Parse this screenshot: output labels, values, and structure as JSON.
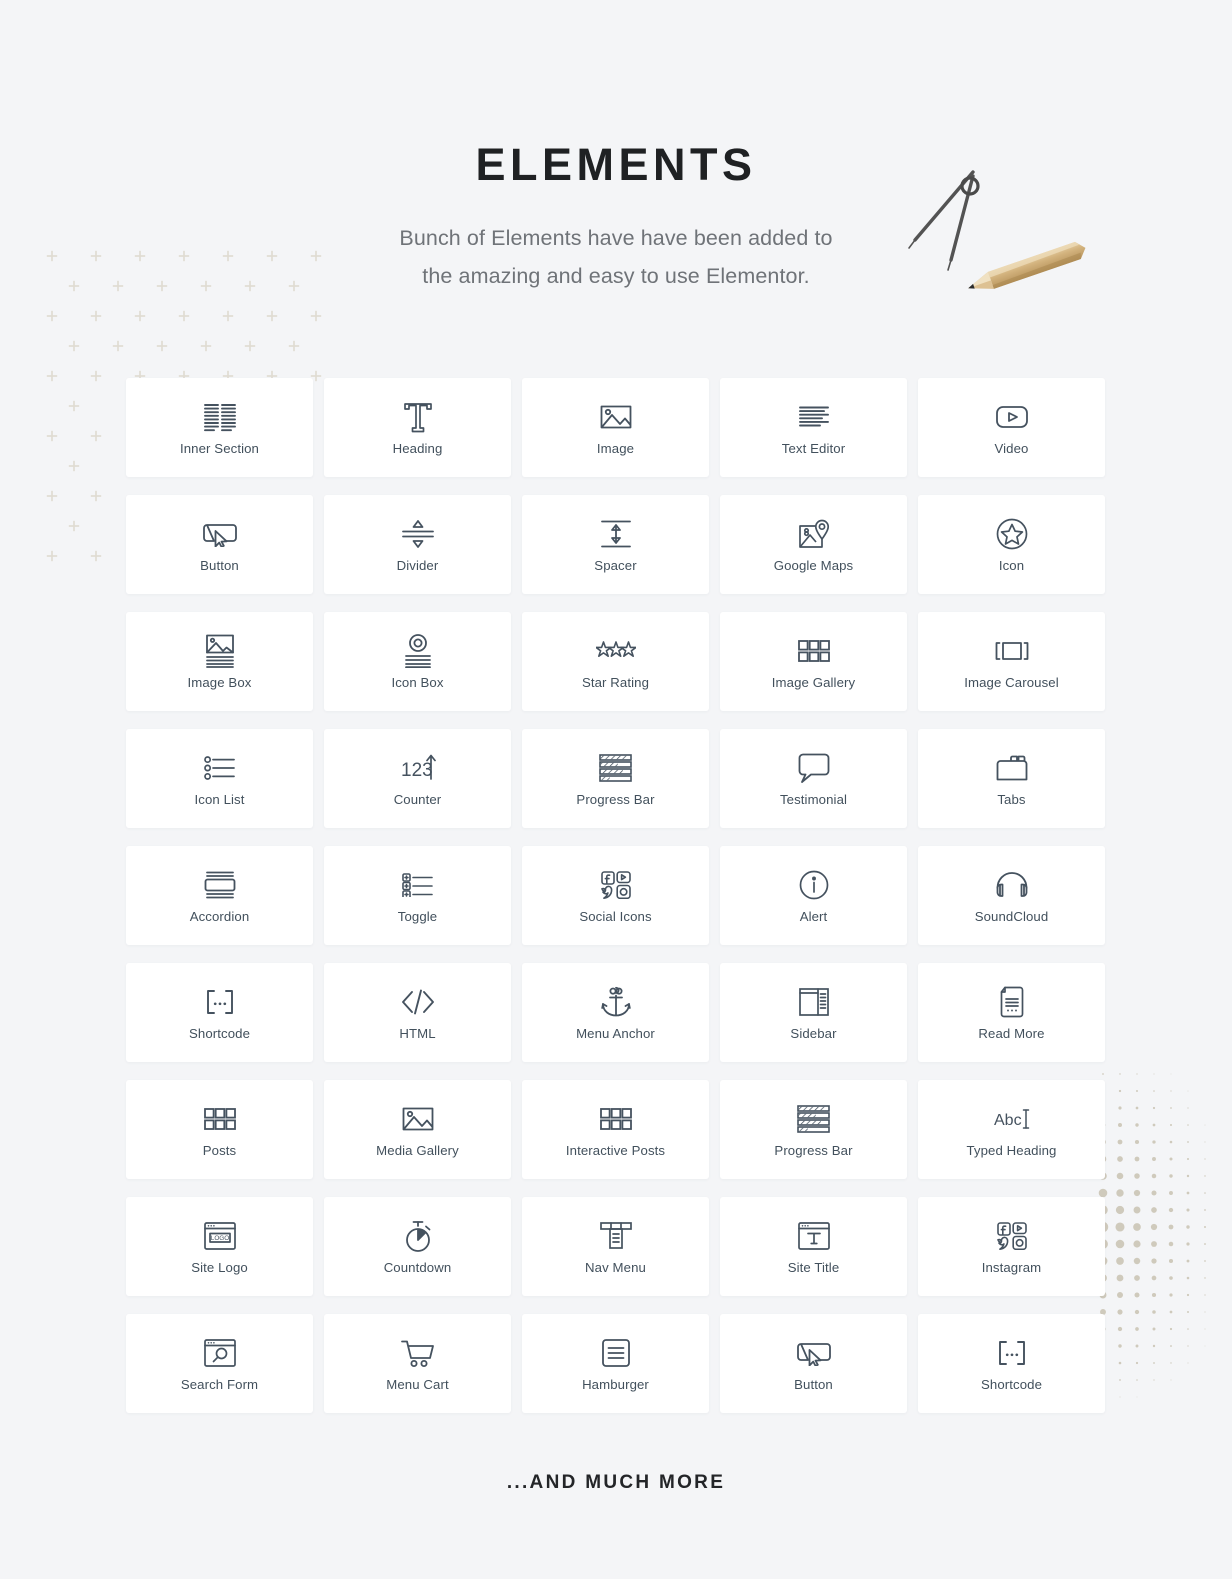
{
  "header": {
    "title": "ELEMENTS",
    "subtitle_line1": "Bunch of Elements have have been added to",
    "subtitle_line2": "the amazing and easy to use  Elementor."
  },
  "footer": {
    "more_label": "...AND MUCH MORE"
  },
  "colors": {
    "background": "#f4f5f7",
    "card": "#ffffff",
    "icon_stroke": "#45525f",
    "label_text": "#42505c",
    "title_text": "#1f2123",
    "subtitle_text": "#6f7378",
    "decor_plus": "#e0dcd2",
    "decor_dots": "#cfcabc",
    "pencil_wood": "#cdab74"
  },
  "elements": [
    {
      "label": "Inner Section",
      "icon": "inner-section-icon"
    },
    {
      "label": "Heading",
      "icon": "heading-t-icon"
    },
    {
      "label": "Image",
      "icon": "image-icon"
    },
    {
      "label": "Text Editor",
      "icon": "text-editor-icon"
    },
    {
      "label": "Video",
      "icon": "video-play-icon"
    },
    {
      "label": "Button",
      "icon": "button-cursor-icon"
    },
    {
      "label": "Divider",
      "icon": "divider-icon"
    },
    {
      "label": "Spacer",
      "icon": "spacer-icon"
    },
    {
      "label": "Google Maps",
      "icon": "google-maps-pin-icon"
    },
    {
      "label": "Icon",
      "icon": "star-circle-icon"
    },
    {
      "label": "Image Box",
      "icon": "image-box-icon"
    },
    {
      "label": "Icon Box",
      "icon": "icon-box-icon"
    },
    {
      "label": "Star Rating",
      "icon": "star-rating-icon"
    },
    {
      "label": "Image Gallery",
      "icon": "grid-gallery-icon"
    },
    {
      "label": "Image Carousel",
      "icon": "carousel-icon"
    },
    {
      "label": "Icon List",
      "icon": "icon-list-icon"
    },
    {
      "label": "Counter",
      "icon": "counter-123-icon"
    },
    {
      "label": "Progress Bar",
      "icon": "progress-bar-icon"
    },
    {
      "label": "Testimonial",
      "icon": "speech-bubble-icon"
    },
    {
      "label": "Tabs",
      "icon": "tabs-folder-icon"
    },
    {
      "label": "Accordion",
      "icon": "accordion-icon"
    },
    {
      "label": "Toggle",
      "icon": "toggle-list-icon"
    },
    {
      "label": "Social Icons",
      "icon": "social-icons-icon"
    },
    {
      "label": "Alert",
      "icon": "alert-info-icon"
    },
    {
      "label": "SoundCloud",
      "icon": "headphones-icon"
    },
    {
      "label": "Shortcode",
      "icon": "shortcode-brackets-icon"
    },
    {
      "label": "HTML",
      "icon": "code-angle-icon"
    },
    {
      "label": "Menu Anchor",
      "icon": "anchor-icon"
    },
    {
      "label": "Sidebar",
      "icon": "sidebar-layout-icon"
    },
    {
      "label": "Read More",
      "icon": "document-page-icon"
    },
    {
      "label": "Posts",
      "icon": "grid-gallery-icon"
    },
    {
      "label": "Media Gallery",
      "icon": "image-icon"
    },
    {
      "label": "Interactive Posts",
      "icon": "grid-gallery-icon"
    },
    {
      "label": "Progress Bar",
      "icon": "progress-bar-icon"
    },
    {
      "label": "Typed Heading",
      "icon": "typed-abc-icon"
    },
    {
      "label": "Site Logo",
      "icon": "site-logo-browser-icon"
    },
    {
      "label": "Countdown",
      "icon": "stopwatch-icon"
    },
    {
      "label": "Nav Menu",
      "icon": "nav-menu-icon"
    },
    {
      "label": "Site Title",
      "icon": "site-title-browser-icon"
    },
    {
      "label": "Instagram",
      "icon": "social-icons-icon"
    },
    {
      "label": "Search Form",
      "icon": "search-browser-icon"
    },
    {
      "label": "Menu Cart",
      "icon": "shopping-cart-icon"
    },
    {
      "label": "Hamburger",
      "icon": "hamburger-icon"
    },
    {
      "label": "Button",
      "icon": "button-cursor-icon"
    },
    {
      "label": "Shortcode",
      "icon": "shortcode-brackets-icon"
    }
  ]
}
